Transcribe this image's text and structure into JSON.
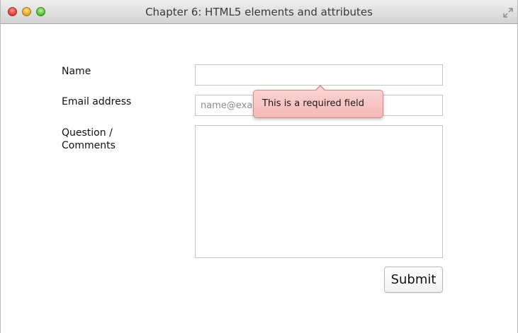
{
  "window": {
    "title": "Chapter 6: HTML5 elements and attributes"
  },
  "form": {
    "name_label": "Name",
    "name_value": "",
    "email_label": "Email address",
    "email_placeholder": "name@example.com",
    "comments_label_line1": "Question /",
    "comments_label_line2": "Comments",
    "comments_value": "",
    "submit_label": "Submit"
  },
  "validation": {
    "message": "This is a required field"
  },
  "colors": {
    "tooltip_background": "#f5b8b8",
    "tooltip_border": "#cf8a8a"
  }
}
